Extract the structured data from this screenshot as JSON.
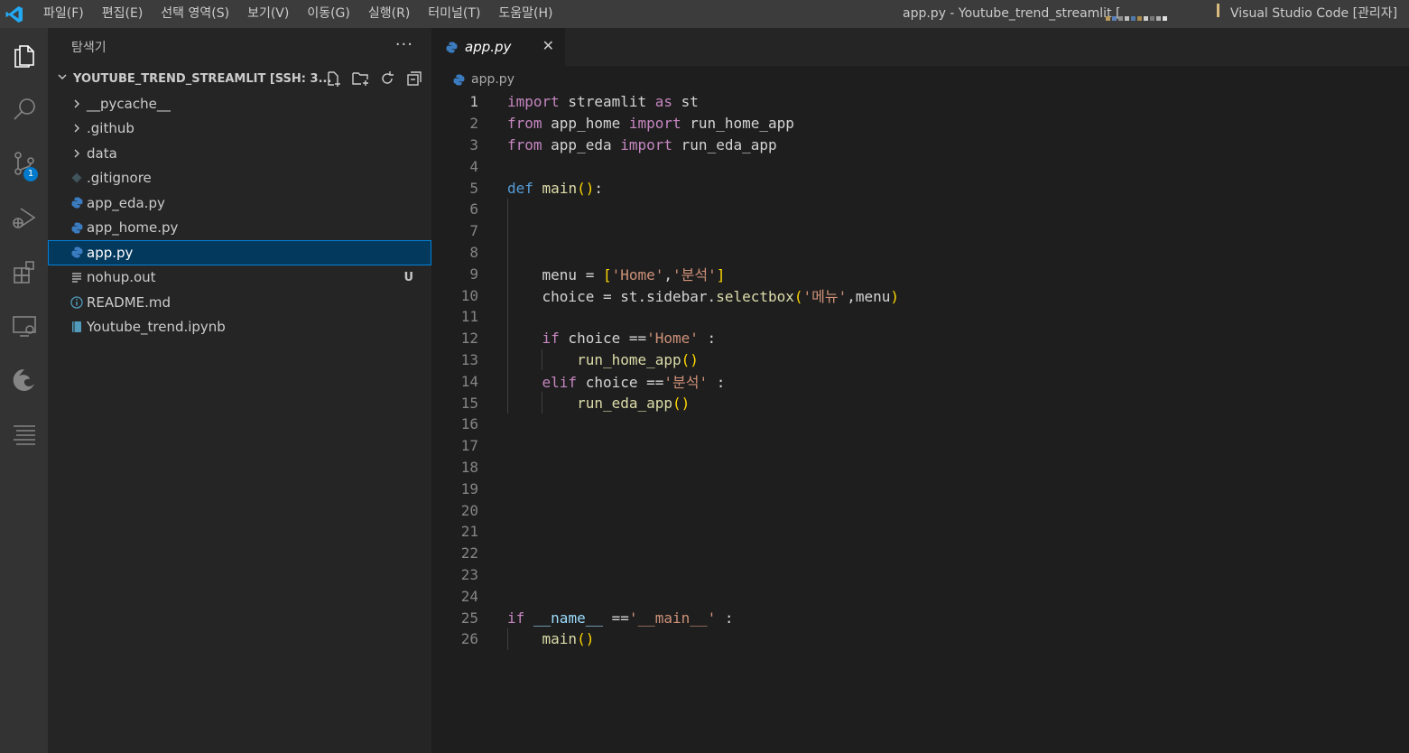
{
  "titlebar": {
    "menu": [
      "파일(F)",
      "편집(E)",
      "선택 영역(S)",
      "보기(V)",
      "이동(G)",
      "실행(R)",
      "터미널(T)",
      "도움말(H)"
    ],
    "window_title": "app.py - Youtube_trend_streamlit [",
    "app_name": "Visual Studio Code [관리자]"
  },
  "activitybar": {
    "icons": [
      "explorer-icon",
      "search-icon",
      "source-control-icon",
      "run-debug-icon",
      "extensions-icon",
      "remote-explorer-icon",
      "edge-icon",
      "outline-icon"
    ],
    "scm_badge": "1"
  },
  "sidebar": {
    "title": "탐색기",
    "more": "···",
    "folder": "YOUTUBE_TREND_STREAMLIT [SSH: 3...",
    "items": [
      {
        "label": "__pycache__",
        "type": "folder"
      },
      {
        "label": ".github",
        "type": "folder"
      },
      {
        "label": "data",
        "type": "folder"
      },
      {
        "label": ".gitignore",
        "type": "git"
      },
      {
        "label": "app_eda.py",
        "type": "python"
      },
      {
        "label": "app_home.py",
        "type": "python"
      },
      {
        "label": "app.py",
        "type": "python",
        "selected": true
      },
      {
        "label": "nohup.out",
        "type": "text",
        "decoration": "U"
      },
      {
        "label": "README.md",
        "type": "info"
      },
      {
        "label": "Youtube_trend.ipynb",
        "type": "notebook"
      }
    ]
  },
  "editor": {
    "tab_label": "app.py",
    "tab_close": "✕",
    "breadcrumb": "app.py",
    "line_numbers": [
      "1",
      "2",
      "3",
      "4",
      "5",
      "6",
      "7",
      "8",
      "9",
      "10",
      "11",
      "12",
      "13",
      "14",
      "15",
      "16",
      "17",
      "18",
      "19",
      "20",
      "21",
      "22",
      "23",
      "24",
      "25",
      "26"
    ]
  }
}
